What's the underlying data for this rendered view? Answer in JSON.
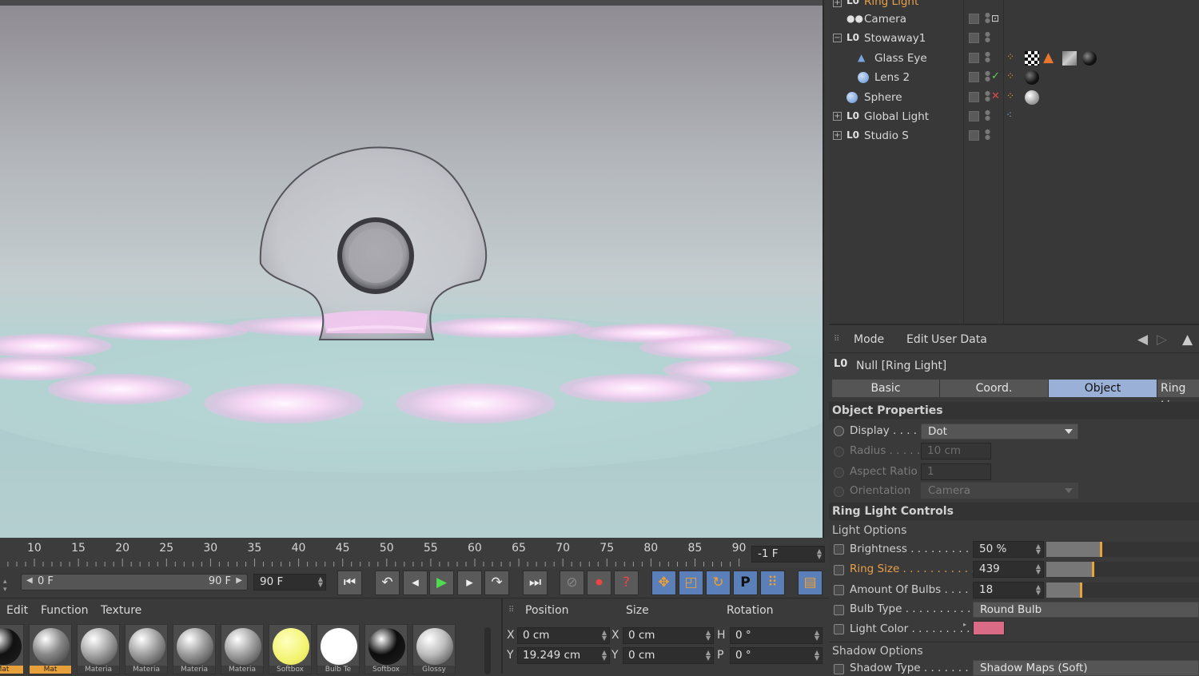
{
  "object_manager": {
    "partial_top_item": "Ring Light",
    "items": [
      {
        "name": "Camera"
      },
      {
        "name": "Stowaway1"
      },
      {
        "name": "Glass Eye"
      },
      {
        "name": "Lens 2"
      },
      {
        "name": "Sphere"
      },
      {
        "name": "Global Light"
      },
      {
        "name": "Studio S"
      }
    ]
  },
  "attributes": {
    "menu": {
      "mode": "Mode",
      "edit": "Edit",
      "user_data": "User Data"
    },
    "object_title": "Null [Ring Light]",
    "tabs": [
      "Basic",
      "Coord.",
      "Object",
      "Ring Lig"
    ],
    "active_tab": "Object",
    "object_properties": {
      "heading": "Object Properties",
      "display_label": "Display . . . . .",
      "display_value": "Dot",
      "radius_label": "Radius . . . . .",
      "radius_value": "10 cm",
      "aspect_label": "Aspect Ratio",
      "aspect_value": "1",
      "orientation_label": "Orientation",
      "orientation_value": "Camera"
    },
    "ring_light_controls": {
      "heading": "Ring Light Controls",
      "light_options": "Light Options",
      "brightness_label": "Brightness . . . . . . . . . . .",
      "brightness_value": "50 %",
      "brightness_level": 0.36,
      "ring_size_label": "Ring Size . . . . . . . . . . . .",
      "ring_size_value": "439",
      "ring_size_level": 0.31,
      "bulbs_label": "Amount Of Bulbs . . . . .",
      "bulbs_value": "18",
      "bulbs_level": 0.23,
      "bulb_type_label": "Bulb Type . . . . . . . . . . . .",
      "bulb_type_value": "Round Bulb",
      "light_color_label": "Light Color . . . . . . . . .",
      "light_color": "#d96b86",
      "shadow_options": "Shadow Options",
      "shadow_type_label": "Shadow Type . . . . . . . .",
      "shadow_type_value": "Shadow Maps (Soft)"
    }
  },
  "timeline": {
    "ticks": [
      "10",
      "15",
      "20",
      "25",
      "30",
      "35",
      "40",
      "45",
      "50",
      "55",
      "60",
      "65",
      "70",
      "75",
      "80",
      "85",
      "90"
    ],
    "current_frame": "-1 F"
  },
  "transport": {
    "range_start": "0 F",
    "range_end": "90 F",
    "end_frame": "90 F"
  },
  "material_manager": {
    "menu": [
      "Edit",
      "Function",
      "Texture"
    ],
    "materials": [
      {
        "label": "Mat",
        "color": "#111111"
      },
      {
        "label": "Mat",
        "color": "#888888"
      },
      {
        "label": "Materia",
        "color": "#a8a8a8"
      },
      {
        "label": "Materia",
        "color": "#a0a0a0"
      },
      {
        "label": "Materia",
        "color": "#9c9c9c"
      },
      {
        "label": "Materia",
        "color": "#a3a3a3"
      },
      {
        "label": "Softbox",
        "color": "#f3f370"
      },
      {
        "label": "Bulb Te",
        "color": "#ffffff"
      },
      {
        "label": "Softbox",
        "color": "#0d0d0d"
      },
      {
        "label": "Glossy",
        "color": "#bdbdbd"
      }
    ]
  },
  "coordinates": {
    "headers": {
      "position": "Position",
      "size": "Size",
      "rotation": "Rotation"
    },
    "rows": [
      {
        "axis": "X",
        "pos": "0 cm",
        "saxis": "X",
        "size": "0 cm",
        "raxis": "H",
        "rot": "0 °"
      },
      {
        "axis": "Y",
        "pos": "19.249 cm",
        "saxis": "Y",
        "size": "0 cm",
        "raxis": "P",
        "rot": "0 °"
      }
    ]
  }
}
